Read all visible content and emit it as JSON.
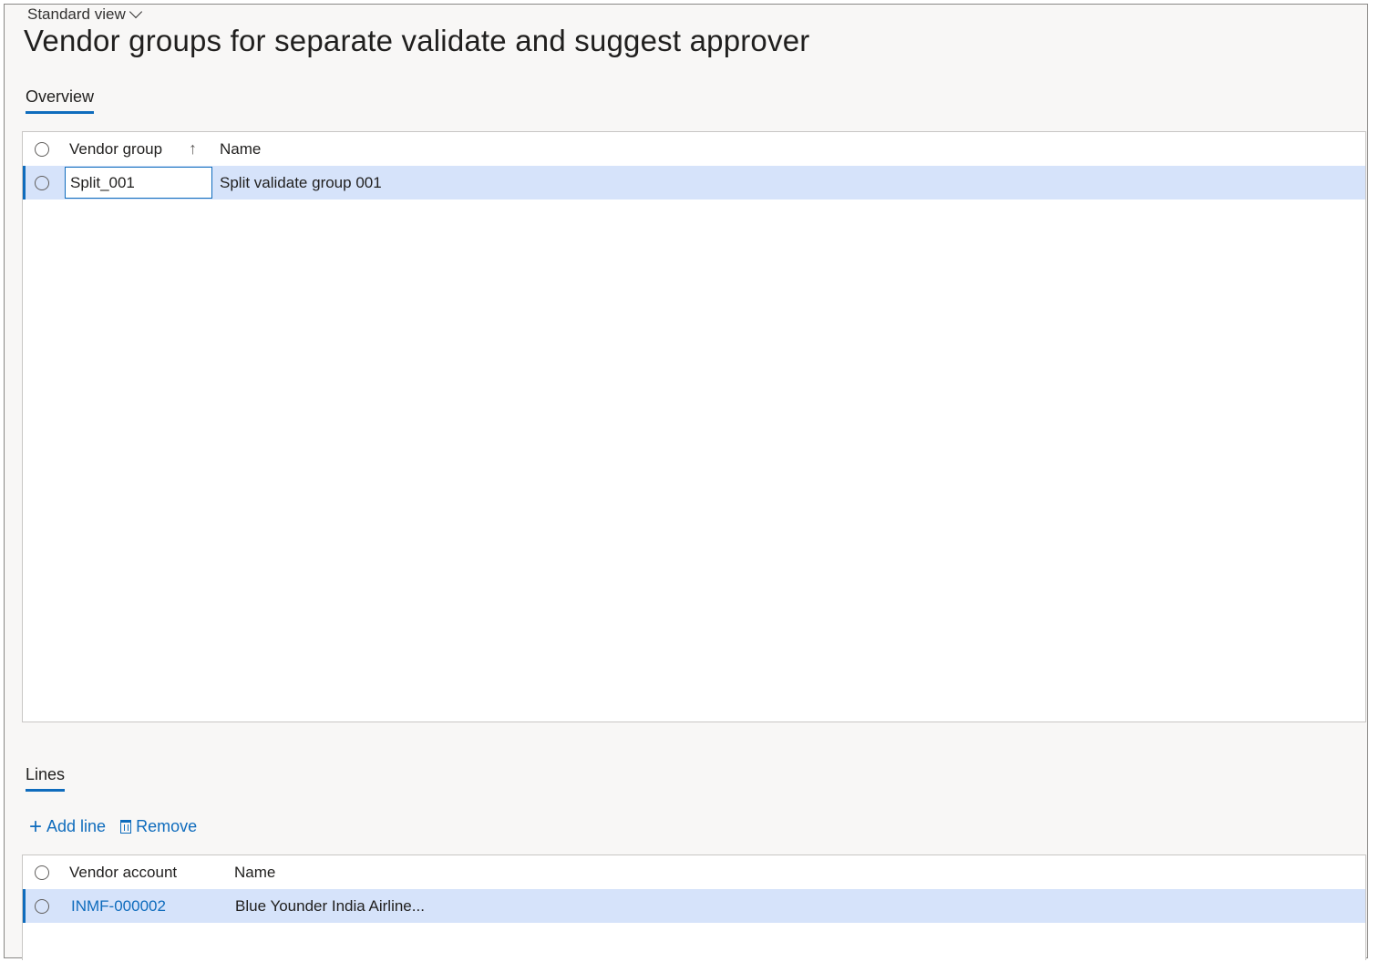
{
  "header": {
    "view_selector": "Standard view",
    "title": "Vendor groups for separate validate and suggest approver"
  },
  "overview": {
    "tab_label": "Overview",
    "columns": [
      "Vendor group",
      "Name"
    ],
    "rows": [
      {
        "vendor_group": "Split_001",
        "name": "Split validate group 001"
      }
    ]
  },
  "lines": {
    "tab_label": "Lines",
    "toolbar": {
      "add_line": "Add line",
      "remove": "Remove"
    },
    "columns": [
      "Vendor account",
      "Name"
    ],
    "rows": [
      {
        "vendor_account": "INMF-000002",
        "name": "Blue Younder India Airline..."
      }
    ]
  },
  "colors": {
    "accent": "#0f6cbd",
    "selected_row": "#d6e3fa"
  }
}
